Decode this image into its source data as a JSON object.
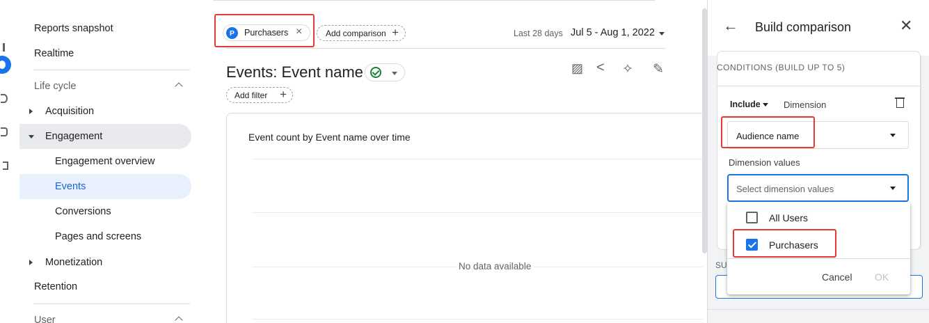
{
  "sidebar": {
    "items": [
      {
        "label": "Reports snapshot"
      },
      {
        "label": "Realtime"
      },
      {
        "label": "Life cycle"
      },
      {
        "label": "Acquisition"
      },
      {
        "label": "Engagement"
      },
      {
        "label": "Engagement overview"
      },
      {
        "label": "Events"
      },
      {
        "label": "Conversions"
      },
      {
        "label": "Pages and screens"
      },
      {
        "label": "Monetization"
      },
      {
        "label": "Retention"
      },
      {
        "label": "User"
      }
    ],
    "active_item": "Events"
  },
  "comparison_bar": {
    "chip": {
      "avatar_letter": "P",
      "label": "Purchasers",
      "close_glyph": "×"
    },
    "add_comparison_label": "Add comparison",
    "plus_glyph": "+"
  },
  "date": {
    "range_label": "Last 28 days",
    "value": "Jul 5 - Aug 1, 2022"
  },
  "report": {
    "title": "Events: Event name",
    "add_filter_label": "Add filter",
    "tools": {
      "compare_icon": "▨",
      "share_icon": "<",
      "insights_icon": "✧",
      "edit_icon": "✎"
    }
  },
  "chart": {
    "title": "Event count by Event name over time",
    "empty_message": "No data available"
  },
  "panel": {
    "back_glyph": "←",
    "title": "Build comparison",
    "close_glyph": "✕",
    "conditions_heading": "CONDITIONS (BUILD UP TO 5)",
    "include_label": "Include",
    "dimension_label": "Dimension",
    "dimension_select_value": "Audience name",
    "dimension_values_label": "Dimension values",
    "dimension_values_placeholder": "Select dimension values",
    "options": [
      {
        "label": "All Users",
        "checked": false
      },
      {
        "label": "Purchasers",
        "checked": true
      }
    ],
    "cancel_label": "Cancel",
    "ok_label": "OK",
    "partial_label": "SU"
  },
  "colors": {
    "accent": "#1a73e8",
    "highlight": "#e53935",
    "active_nav_bg": "#e8f0fe"
  }
}
